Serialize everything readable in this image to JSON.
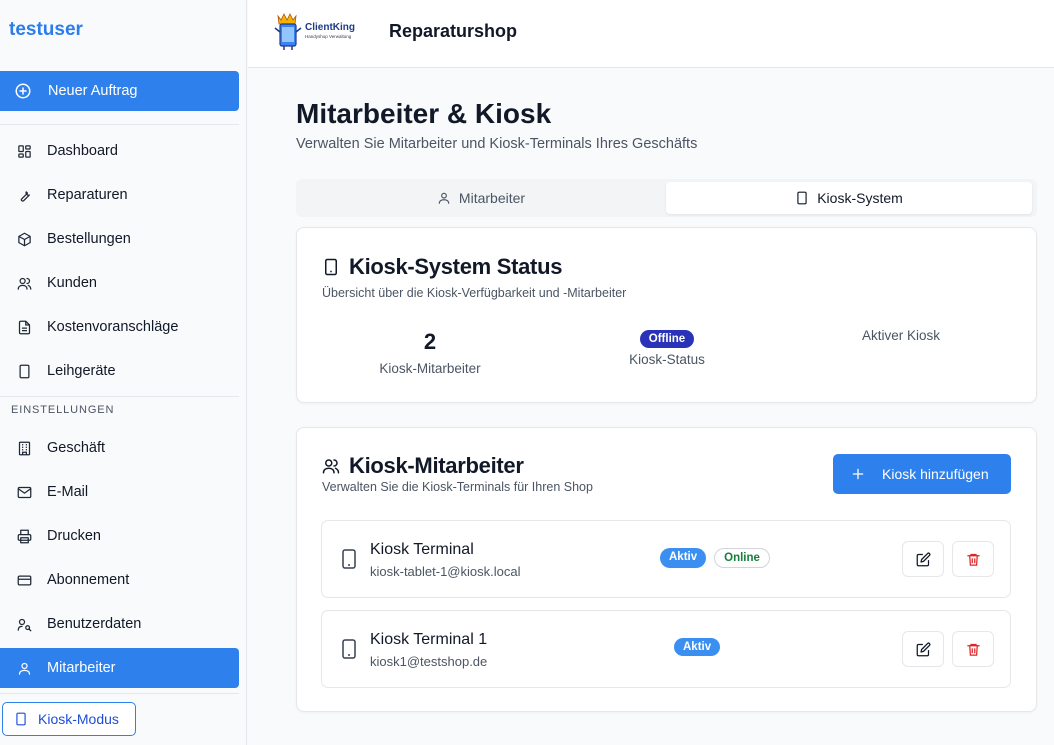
{
  "sidebar": {
    "user": "testuser",
    "new_order": "Neuer Auftrag",
    "items": [
      {
        "label": "Dashboard",
        "icon": "dashboard-icon"
      },
      {
        "label": "Reparaturen",
        "icon": "wrench-icon"
      },
      {
        "label": "Bestellungen",
        "icon": "package-icon"
      },
      {
        "label": "Kunden",
        "icon": "users-icon"
      },
      {
        "label": "Kostenvoranschläge",
        "icon": "document-icon"
      },
      {
        "label": "Leihgeräte",
        "icon": "tablet-icon"
      }
    ],
    "settings_heading": "EINSTELLUNGEN",
    "settings_items": [
      {
        "label": "Geschäft",
        "icon": "building-icon"
      },
      {
        "label": "E-Mail",
        "icon": "mail-icon"
      },
      {
        "label": "Drucken",
        "icon": "printer-icon"
      },
      {
        "label": "Abonnement",
        "icon": "credit-card-icon"
      },
      {
        "label": "Benutzerdaten",
        "icon": "user-key-icon"
      },
      {
        "label": "Mitarbeiter",
        "icon": "user-icon",
        "active": true
      }
    ],
    "kiosk_mode": "Kiosk-Modus"
  },
  "header": {
    "logo_name": "ClientKing",
    "logo_tagline": "Handyshop Verwaltung",
    "shop_name": "Reparaturshop"
  },
  "page": {
    "title": "Mitarbeiter & Kiosk",
    "subtitle": "Verwalten Sie Mitarbeiter und Kiosk-Terminals Ihres Geschäfts"
  },
  "tabs": [
    {
      "label": "Mitarbeiter",
      "active": false
    },
    {
      "label": "Kiosk-System",
      "active": true
    }
  ],
  "status_card": {
    "title": "Kiosk-System Status",
    "subtitle": "Übersicht über die Kiosk-Verfügbarkeit und -Mitarbeiter",
    "employee_count": "2",
    "employee_count_label": "Kiosk-Mitarbeiter",
    "status_badge": "Offline",
    "status_label": "Kiosk-Status",
    "active_kiosk_label": "Aktiver Kiosk"
  },
  "kiosk_card": {
    "title": "Kiosk-Mitarbeiter",
    "subtitle": "Verwalten Sie die Kiosk-Terminals für Ihren Shop",
    "add_button": "Kiosk hinzufügen",
    "kiosks": [
      {
        "name": "Kiosk Terminal",
        "email": "kiosk-tablet-1@kiosk.local",
        "status": "Aktiv",
        "connection": "Online"
      },
      {
        "name": "Kiosk Terminal 1",
        "email": "kiosk1@testshop.de",
        "status": "Aktiv",
        "connection": ""
      }
    ]
  },
  "colors": {
    "accent": "#2e80ec",
    "offline_badge": "#2a33b8",
    "online_text": "#15803d",
    "delete": "#dc2626"
  }
}
